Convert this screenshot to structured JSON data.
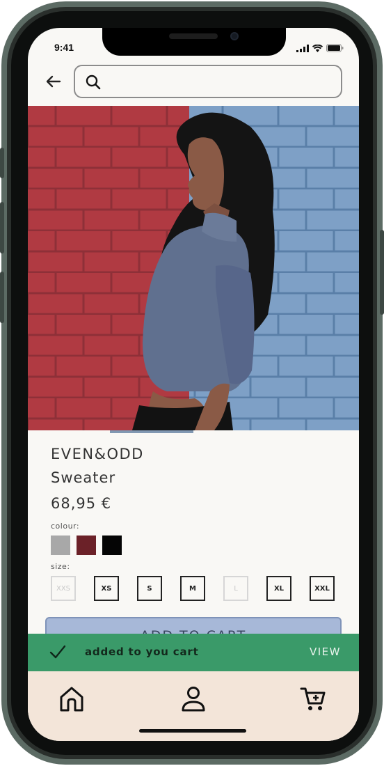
{
  "status": {
    "time": "9:41"
  },
  "search": {
    "placeholder": "",
    "value": ""
  },
  "product": {
    "brand": "EVEN&ODD",
    "name": "Sweater",
    "price": "68,95 €",
    "colour_label": "colour:",
    "colours": [
      "#a8a8a8",
      "#6b2128",
      "#050505"
    ],
    "size_label": "size:",
    "sizes": [
      {
        "label": "XXS",
        "available": false
      },
      {
        "label": "XS",
        "available": true
      },
      {
        "label": "S",
        "available": true
      },
      {
        "label": "M",
        "available": true
      },
      {
        "label": "L",
        "available": false
      },
      {
        "label": "XL",
        "available": true
      },
      {
        "label": "XXL",
        "available": true
      }
    ],
    "cart_button": "ADD TO CART"
  },
  "toast": {
    "message": "added to you cart",
    "action": "VIEW",
    "color": "#3a9a69"
  },
  "tabs": [
    {
      "name": "home",
      "icon": "home-icon"
    },
    {
      "name": "profile",
      "icon": "user-icon"
    },
    {
      "name": "cart",
      "icon": "cart-icon"
    }
  ]
}
